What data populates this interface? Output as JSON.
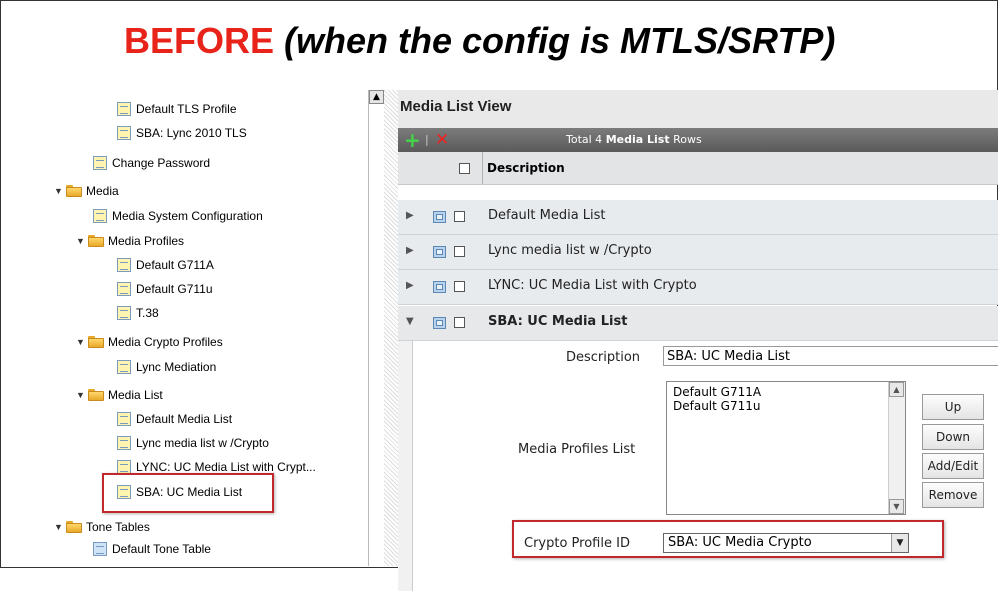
{
  "banner": {
    "before": "BEFORE",
    "rest": " (when the config is MTLS/SRTP)"
  },
  "tree": {
    "items": [
      {
        "label": "Default TLS Profile",
        "indent": 3,
        "icon": "doc-icon"
      },
      {
        "label": "SBA: Lync 2010 TLS",
        "indent": 3,
        "icon": "doc-icon"
      },
      {
        "label": "Change Password",
        "indent": 2,
        "icon": "doc-icon"
      },
      {
        "label": "Media",
        "indent": 1,
        "icon": "folder-icon",
        "expanded": true
      },
      {
        "label": "Media System Configuration",
        "indent": 2,
        "icon": "doc-icon"
      },
      {
        "label": "Media Profiles",
        "indent": 2,
        "icon": "folder-icon",
        "expanded": true
      },
      {
        "label": "Default G711A",
        "indent": 3,
        "icon": "doc-icon"
      },
      {
        "label": "Default G711u",
        "indent": 3,
        "icon": "doc-icon"
      },
      {
        "label": "T.38",
        "indent": 3,
        "icon": "doc-icon"
      },
      {
        "label": "Media Crypto Profiles",
        "indent": 2,
        "icon": "folder-icon",
        "expanded": true
      },
      {
        "label": "Lync Mediation",
        "indent": 3,
        "icon": "doc-icon"
      },
      {
        "label": "Media List",
        "indent": 2,
        "icon": "folder-icon",
        "expanded": true
      },
      {
        "label": "Default Media List",
        "indent": 3,
        "icon": "doc-icon"
      },
      {
        "label": "Lync media list w /Crypto",
        "indent": 3,
        "icon": "doc-icon"
      },
      {
        "label": "LYNC: UC Media List with Crypt...",
        "indent": 3,
        "icon": "doc-icon"
      },
      {
        "label": "SBA: UC Media List",
        "indent": 3,
        "icon": "doc-icon"
      },
      {
        "label": "Tone Tables",
        "indent": 1,
        "icon": "folder-icon",
        "expanded": true
      },
      {
        "label": "Default Tone Table",
        "indent": 2,
        "icon": "doc-icon"
      }
    ]
  },
  "panel": {
    "title": "Media List View",
    "toolbar": {
      "total_prefix": "Total 4 ",
      "total_bold": "Media List",
      "total_suffix": " Rows"
    },
    "header": {
      "description": "Description"
    },
    "rows": [
      {
        "description": "Default Media List"
      },
      {
        "description": "Lync media list w /Crypto"
      },
      {
        "description": "LYNC: UC Media List with Crypto"
      },
      {
        "description": "SBA: UC Media List"
      }
    ],
    "detail": {
      "description_label": "Description",
      "description_value": "SBA: UC Media List",
      "profiles_label": "Media Profiles List",
      "profiles": [
        "Default G711A",
        "Default G711u"
      ],
      "buttons": {
        "up": "Up",
        "down": "Down",
        "add_edit": "Add/Edit",
        "remove": "Remove"
      },
      "crypto_label": "Crypto Profile ID",
      "crypto_value": "SBA: UC Media Crypto"
    }
  },
  "colors": {
    "accent_red": "#e8231a",
    "highlight_border": "#c0282d",
    "add_green": "#44d44a"
  }
}
